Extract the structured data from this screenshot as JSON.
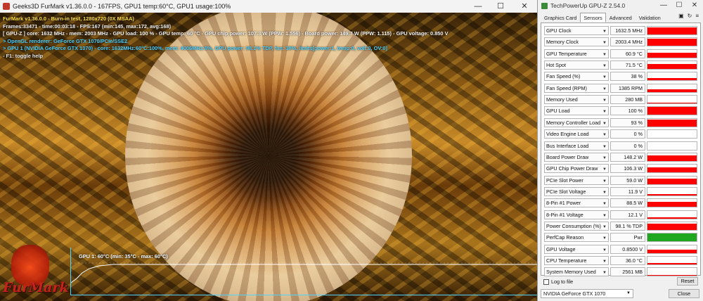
{
  "furmark": {
    "title": "Geeks3D FurMark v1.36.0.0 - 167FPS, GPU1 temp:60°C, GPU1 usage:100%",
    "overlay": {
      "line1": "FurMark v1.36.0.0 - Burn-in test, 1280x720 (0X MSAA)",
      "line2": "Frames:33471 - time:00:03:18 - FPS:167 (min:145, max:172, avg:168)",
      "line3": "[ GPU-Z ] core: 1632 MHz - mem: 2003 MHz - GPU load: 100 % - GPU temp: 60 °C - GPU chip power: 107.3 W (PPW: 1.556) - Board power: 149.7 W (PPW: 1.115) - GPU voltage: 0.850 V",
      "line4": "> OpenGL renderer: GeForce GTX 1070/PCIe/SSE2",
      "line5": "> GPU 1 (NVIDIA GeForce GTX 1070) - core: 1632MHz:60°C:100%, mem: 4006MHz:8%, GPU power: 98.1% TDP, fan: 38%, limits[power:1, temp:0, volt:0, OV:0]",
      "line6": "- F1: toggle help"
    },
    "graph_label": "GPU 1: 60°C (min: 35°C - max: 60°C)",
    "logo_text": "FurMark",
    "window_controls": {
      "minimize": "—",
      "maximize": "☐",
      "close": "✕"
    }
  },
  "gpuz": {
    "title": "TechPowerUp GPU-Z 2.54.0",
    "window_controls": {
      "minimize": "—",
      "maximize": "☐",
      "close": "✕"
    },
    "tabs": [
      "Graphics Card",
      "Sensors",
      "Advanced",
      "Validation"
    ],
    "active_tab": "Sensors",
    "tool_icons": [
      "camera-icon",
      "refresh-icon",
      "menu-icon"
    ],
    "sensors": [
      {
        "name": "GPU Clock",
        "value": "1632.5 MHz",
        "fill": 0.95,
        "color": "#ff0000"
      },
      {
        "name": "Memory Clock",
        "value": "2003.4 MHz",
        "fill": 0.95,
        "color": "#ff0000"
      },
      {
        "name": "GPU Temperature",
        "value": "60.9 °C",
        "fill": 0.6,
        "color": "#ff0000"
      },
      {
        "name": "Hot Spot",
        "value": "71.5 °C",
        "fill": 0.6,
        "color": "#ff0000"
      },
      {
        "name": "Fan Speed (%)",
        "value": "38 %",
        "fill": 0.35,
        "color": "#ff0000"
      },
      {
        "name": "Fan Speed (RPM)",
        "value": "1385 RPM",
        "fill": 0.35,
        "color": "#ff0000"
      },
      {
        "name": "Memory Used",
        "value": "280 MB",
        "fill": 0.08,
        "color": "#ff0000"
      },
      {
        "name": "GPU Load",
        "value": "100 %",
        "fill": 1.0,
        "color": "#ff0000"
      },
      {
        "name": "Memory Controller Load",
        "value": "93 %",
        "fill": 0.93,
        "color": "#ff0000"
      },
      {
        "name": "Video Engine Load",
        "value": "0 %",
        "fill": 0.0,
        "color": "#ff0000"
      },
      {
        "name": "Bus Interface Load",
        "value": "0 %",
        "fill": 0.0,
        "color": "#ff0000"
      },
      {
        "name": "Board Power Draw",
        "value": "148.2 W",
        "fill": 0.75,
        "color": "#ff0000"
      },
      {
        "name": "GPU Chip Power Draw",
        "value": "106.3 W",
        "fill": 0.7,
        "color": "#ff0000"
      },
      {
        "name": "PCIe Slot Power",
        "value": "59.0 W",
        "fill": 0.7,
        "color": "#ff0000"
      },
      {
        "name": "PCIe Slot Voltage",
        "value": "11.9 V",
        "fill": 0.15,
        "color": "#ff0000"
      },
      {
        "name": "8-Pin #1 Power",
        "value": "88.5 W",
        "fill": 0.7,
        "color": "#ff0000"
      },
      {
        "name": "8-Pin #1 Voltage",
        "value": "12.1 V",
        "fill": 0.15,
        "color": "#ff0000"
      },
      {
        "name": "Power Consumption (%)",
        "value": "98.1 % TDP",
        "fill": 0.85,
        "color": "#ff0000"
      },
      {
        "name": "PerfCap Reason",
        "value": "Pwr",
        "fill": 1.0,
        "color": "#1fa81f"
      },
      {
        "name": "GPU Voltage",
        "value": "0.8500 V",
        "fill": 0.45,
        "color": "#ff0000"
      },
      {
        "name": "CPU Temperature",
        "value": "36.0 °C",
        "fill": 0.2,
        "color": "#ff0000"
      },
      {
        "name": "System Memory Used",
        "value": "2561 MB",
        "fill": 0.12,
        "color": "#ff0000"
      }
    ],
    "log_label": "Log to file",
    "reset_label": "Reset",
    "device": "NVIDIA GeForce GTX 1070",
    "close_label": "Close"
  }
}
